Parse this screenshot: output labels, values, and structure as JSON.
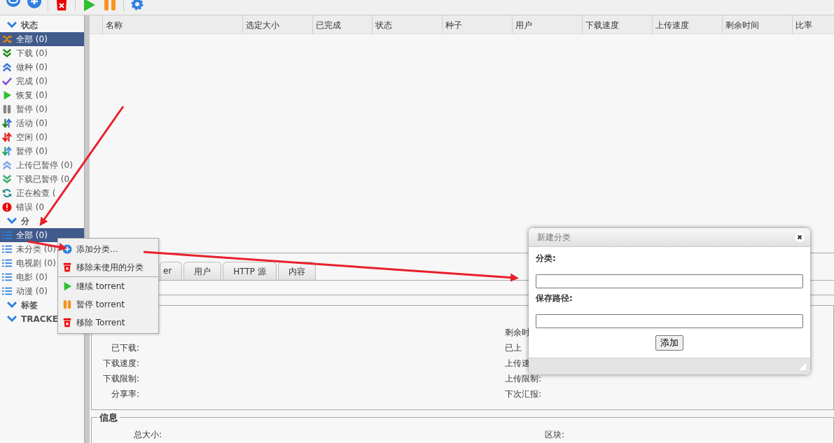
{
  "sidebar": {
    "sections": [
      {
        "title": "状态",
        "expanded": true,
        "items": [
          {
            "label": "全部 (0)",
            "kind": "shuffle",
            "selected": true
          },
          {
            "label": "下载 (0)",
            "kind": "down",
            "selected": false
          },
          {
            "label": "做种 (0)",
            "kind": "up",
            "selected": false
          },
          {
            "label": "完成 (0)",
            "kind": "check",
            "selected": false
          },
          {
            "label": "恢复 (0)",
            "kind": "play",
            "selected": false
          },
          {
            "label": "暂停 (0)",
            "kind": "pause",
            "selected": false
          },
          {
            "label": "活动 (0)",
            "kind": "active",
            "selected": false
          },
          {
            "label": "空闲 (0)",
            "kind": "idle",
            "selected": false
          },
          {
            "label": "暂停 (0)",
            "kind": "stalled",
            "selected": false
          },
          {
            "label": "上传已暂停 (0)",
            "kind": "up-paused",
            "selected": false
          },
          {
            "label": "下载已暂停 (0",
            "kind": "down-paused",
            "selected": false
          },
          {
            "label": "正在检查 (",
            "kind": "checking",
            "selected": false
          },
          {
            "label": "错误 (0",
            "kind": "error",
            "selected": false
          }
        ]
      },
      {
        "title": "分",
        "expanded": true,
        "items": [
          {
            "label": "全部 (0)",
            "kind": "list",
            "selected": true
          },
          {
            "label": "未分类 (0)",
            "kind": "list",
            "selected": false
          },
          {
            "label": "电视剧 (0)",
            "kind": "list",
            "selected": false
          },
          {
            "label": "电影 (0)",
            "kind": "list",
            "selected": false
          },
          {
            "label": "动漫 (0)",
            "kind": "list",
            "selected": false
          }
        ]
      },
      {
        "title": "标签",
        "expanded": true
      },
      {
        "title": "TRACKE",
        "expanded": true
      }
    ]
  },
  "table": {
    "columns": [
      "名称",
      "选定大小",
      "已完成",
      "状态",
      "种子",
      "用户",
      "下载速度",
      "上传速度",
      "剩余时间",
      "比率"
    ]
  },
  "detail_tabs": [
    {
      "label": "er",
      "selected": false
    },
    {
      "label": "用户",
      "selected": false
    },
    {
      "label": "HTTP 源",
      "selected": false
    },
    {
      "label": "内容",
      "selected": false
    }
  ],
  "transfer": {
    "rows": [
      {
        "left": "",
        "right": "剩余时"
      },
      {
        "left": "已下载:",
        "right": "已上"
      },
      {
        "left": "下载速度:",
        "right": "上传速"
      },
      {
        "left": "下载限制:",
        "right": "上传限制:"
      },
      {
        "left": "分享率:",
        "right": "下次汇报:"
      }
    ]
  },
  "info": {
    "title": "信息",
    "rows": [
      {
        "left": "总大小:",
        "right": "区块:"
      }
    ]
  },
  "context_menu": {
    "items": [
      {
        "label": "添加分类...",
        "kind": "add",
        "separator_after": false
      },
      {
        "label": "移除未使用的分类",
        "kind": "remove",
        "separator_after": true
      },
      {
        "label": "继续 torrent",
        "kind": "play",
        "separator_after": false
      },
      {
        "label": "暂停 torrent",
        "kind": "pause",
        "separator_after": false
      },
      {
        "label": "移除 Torrent",
        "kind": "remove",
        "separator_after": false
      }
    ]
  },
  "dialog": {
    "title": "新建分类",
    "fields": [
      {
        "label": "分类:"
      },
      {
        "label": "保存路径:"
      }
    ],
    "button": "添加"
  }
}
